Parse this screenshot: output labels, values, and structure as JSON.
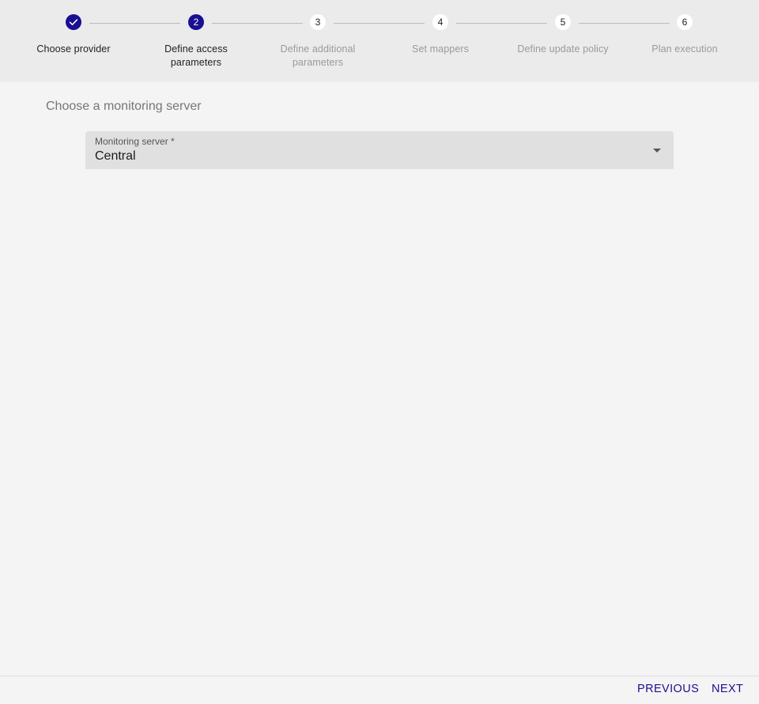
{
  "stepper": {
    "steps": [
      {
        "number": "1",
        "label": "Choose provider",
        "state": "done",
        "icon": "check-icon"
      },
      {
        "number": "2",
        "label": "Define access parameters",
        "state": "active"
      },
      {
        "number": "3",
        "label": "Define additional parameters",
        "state": "todo"
      },
      {
        "number": "4",
        "label": "Set mappers",
        "state": "todo"
      },
      {
        "number": "5",
        "label": "Define update policy",
        "state": "todo"
      },
      {
        "number": "6",
        "label": "Plan execution",
        "state": "todo"
      }
    ]
  },
  "main": {
    "section_title": "Choose a monitoring server",
    "monitoring_server": {
      "label": "Monitoring server *",
      "value": "Central"
    }
  },
  "footer": {
    "previous_label": "PREVIOUS",
    "next_label": "NEXT"
  },
  "colors": {
    "accent": "#1a0f91",
    "stepper_bg": "#ebebeb",
    "page_bg": "#f4f4f4",
    "field_bg": "#e0e0e0"
  }
}
